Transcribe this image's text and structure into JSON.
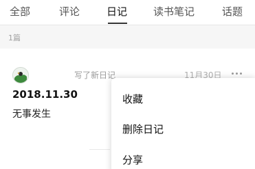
{
  "tabs": [
    {
      "label": "全部"
    },
    {
      "label": "评论"
    },
    {
      "label": "日记"
    },
    {
      "label": "读书笔记"
    },
    {
      "label": "话题"
    }
  ],
  "active_tab": "日记",
  "count_label": "1篇",
  "entry": {
    "action": "写了新日记",
    "date": "11月30日",
    "title": "2018.11.30",
    "body": "无事发生"
  },
  "menu": {
    "items": [
      {
        "label": "收藏"
      },
      {
        "label": "删除日记"
      },
      {
        "label": "分享"
      }
    ]
  },
  "colors": {
    "active_underline": "#333333",
    "muted_text": "#9a9a9a",
    "strip_background": "#f6f6f6"
  }
}
